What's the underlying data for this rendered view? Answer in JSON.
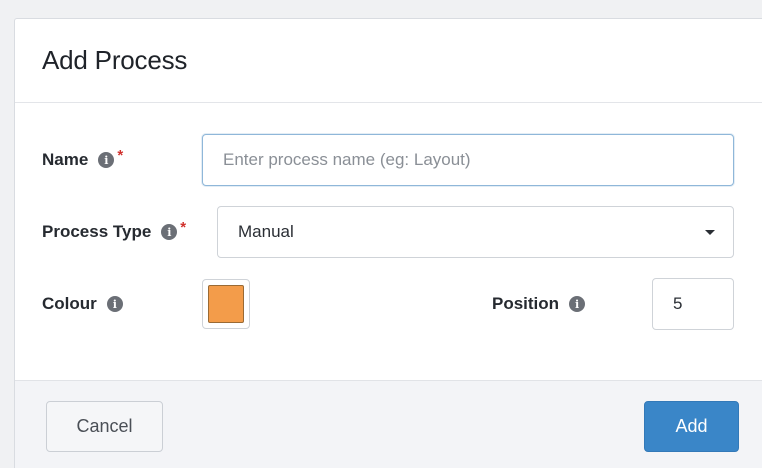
{
  "dialog": {
    "title": "Add Process"
  },
  "form": {
    "name": {
      "label": "Name",
      "placeholder": "Enter process name (eg: Layout)",
      "value": "",
      "required": "*",
      "info_icon": "i"
    },
    "process_type": {
      "label": "Process Type",
      "selected": "Manual",
      "required": "*",
      "info_icon": "i"
    },
    "colour": {
      "label": "Colour",
      "value": "#f39c4a",
      "info_icon": "i"
    },
    "position": {
      "label": "Position",
      "value": "5",
      "info_icon": "i"
    }
  },
  "footer": {
    "cancel_label": "Cancel",
    "add_label": "Add"
  },
  "colors": {
    "accent": "#3a86c8",
    "required": "#d0312d",
    "swatch": "#f39c4a"
  },
  "icons": {
    "info": "info-circle-icon",
    "select_caret": "caret-down-icon"
  }
}
